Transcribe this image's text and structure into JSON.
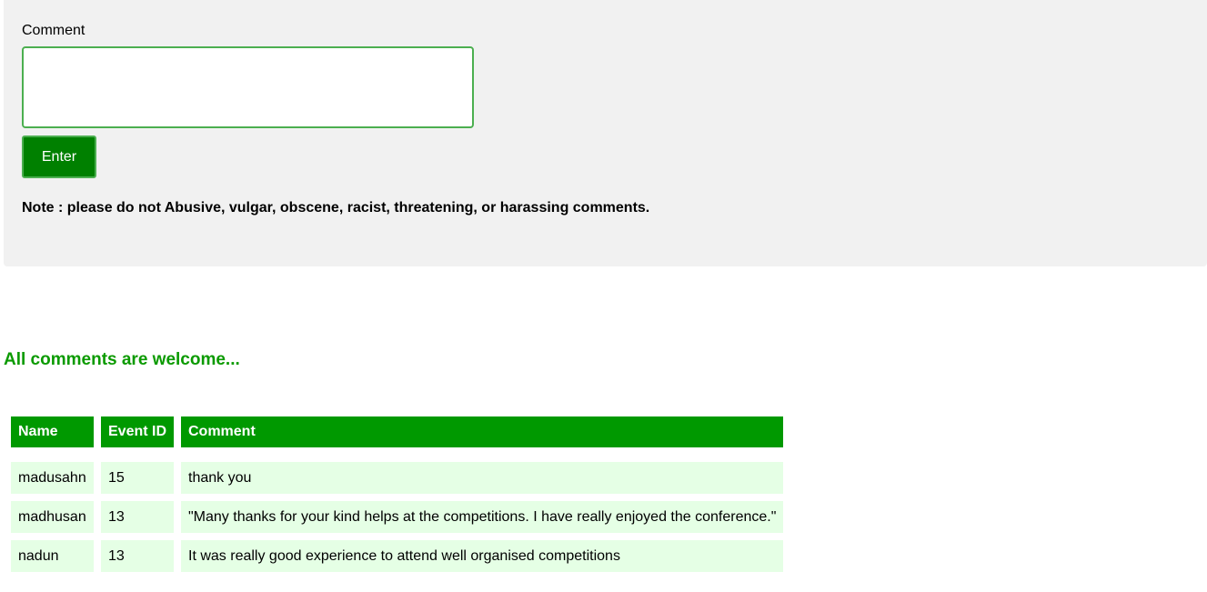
{
  "form": {
    "comment_label": "Comment",
    "comment_value": "",
    "comment_placeholder": "",
    "enter_label": "Enter",
    "note": "Note : please do not Abusive, vulgar, obscene, racist, threatening, or harassing comments."
  },
  "comments_section": {
    "heading": "All comments are welcome...",
    "columns": [
      "Name",
      "Event ID",
      "Comment"
    ],
    "rows": [
      {
        "name": "madusahn",
        "event_id": "15",
        "comment": "thank you"
      },
      {
        "name": "madhusan",
        "event_id": "13",
        "comment": "\"Many thanks for your kind helps at the competitions. I have really enjoyed the conference.\""
      },
      {
        "name": "nadun",
        "event_id": "13",
        "comment": "It was really good experience to attend well organised competitions"
      }
    ]
  },
  "colors": {
    "accent_green": "#009900",
    "button_green": "#008000",
    "heading_green": "#0b9a00",
    "row_background": "#e5ffe5",
    "panel_background": "#f1f1f1"
  }
}
